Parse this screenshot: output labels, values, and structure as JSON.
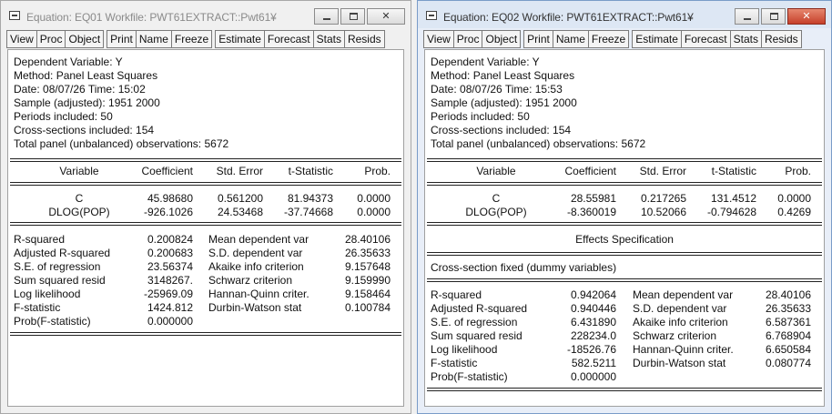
{
  "windows": [
    {
      "id": "eq01",
      "title": "Equation: EQ01   Workfile: PWT61EXTRACT::Pwt61¥",
      "toolbar": [
        [
          "View",
          "Proc",
          "Object"
        ],
        [
          "Print",
          "Name",
          "Freeze"
        ],
        [
          "Estimate",
          "Forecast",
          "Stats",
          "Resids"
        ]
      ],
      "header": [
        "Dependent Variable: Y",
        "Method: Panel Least Squares",
        "Date: 08/07/26   Time: 15:02",
        "Sample (adjusted): 1951 2000",
        "Periods included: 50",
        "Cross-sections included: 154",
        "Total panel (unbalanced) observations: 5672"
      ],
      "columns": [
        "Variable",
        "Coefficient",
        "Std. Error",
        "t-Statistic",
        "Prob."
      ],
      "coefficients": [
        [
          "C",
          "45.98680",
          "0.561200",
          "81.94373",
          "0.0000"
        ],
        [
          "DLOG(POP)",
          "-926.1026",
          "24.53468",
          "-37.74668",
          "0.0000"
        ]
      ],
      "effects_title": "",
      "effects_text": "",
      "stats": [
        [
          "R-squared",
          "0.200824",
          "Mean dependent var",
          "28.40106"
        ],
        [
          "Adjusted R-squared",
          "0.200683",
          "S.D. dependent var",
          "26.35633"
        ],
        [
          "S.E. of regression",
          "23.56374",
          "Akaike info criterion",
          "9.157648"
        ],
        [
          "Sum squared resid",
          "3148267.",
          "Schwarz criterion",
          "9.159990"
        ],
        [
          "Log likelihood",
          "-25969.09",
          "Hannan-Quinn criter.",
          "9.158464"
        ],
        [
          "F-statistic",
          "1424.812",
          "Durbin-Watson stat",
          "0.100784"
        ],
        [
          "Prob(F-statistic)",
          "0.000000",
          "",
          ""
        ]
      ]
    },
    {
      "id": "eq02",
      "title": "Equation: EQ02   Workfile: PWT61EXTRACT::Pwt61¥",
      "toolbar": [
        [
          "View",
          "Proc",
          "Object"
        ],
        [
          "Print",
          "Name",
          "Freeze"
        ],
        [
          "Estimate",
          "Forecast",
          "Stats",
          "Resids"
        ]
      ],
      "header": [
        "Dependent Variable: Y",
        "Method: Panel Least Squares",
        "Date: 08/07/26   Time: 15:53",
        "Sample (adjusted): 1951 2000",
        "Periods included: 50",
        "Cross-sections included: 154",
        "Total panel (unbalanced) observations: 5672"
      ],
      "columns": [
        "Variable",
        "Coefficient",
        "Std. Error",
        "t-Statistic",
        "Prob."
      ],
      "coefficients": [
        [
          "C",
          "28.55981",
          "0.217265",
          "131.4512",
          "0.0000"
        ],
        [
          "DLOG(POP)",
          "-8.360019",
          "10.52066",
          "-0.794628",
          "0.4269"
        ]
      ],
      "effects_title": "Effects Specification",
      "effects_text": "Cross-section fixed (dummy variables)",
      "stats": [
        [
          "R-squared",
          "0.942064",
          "Mean dependent var",
          "28.40106"
        ],
        [
          "Adjusted R-squared",
          "0.940446",
          "S.D. dependent var",
          "26.35633"
        ],
        [
          "S.E. of regression",
          "6.431890",
          "Akaike info criterion",
          "6.587361"
        ],
        [
          "Sum squared resid",
          "228234.0",
          "Schwarz criterion",
          "6.768904"
        ],
        [
          "Log likelihood",
          "-18526.76",
          "Hannan-Quinn criter.",
          "6.650584"
        ],
        [
          "F-statistic",
          "582.5211",
          "Durbin-Watson stat",
          "0.080774"
        ],
        [
          "Prob(F-statistic)",
          "0.000000",
          "",
          ""
        ]
      ]
    }
  ]
}
